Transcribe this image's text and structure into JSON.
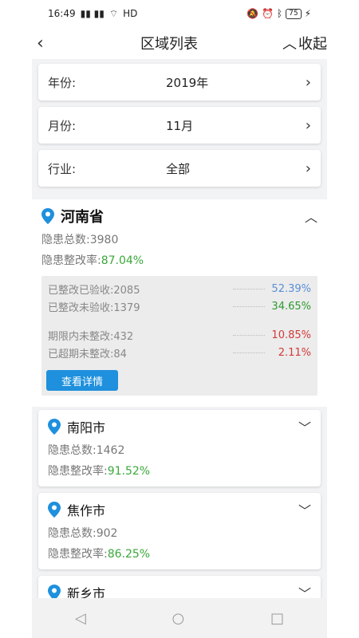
{
  "status": {
    "time": "16:49",
    "signal": "⁴ᴳ ⁴ᴳ",
    "network": "HD",
    "battery": "75"
  },
  "nav": {
    "title": "区域列表",
    "collapse_label": "收起"
  },
  "filters": [
    {
      "label": "年份:",
      "value": "2019年"
    },
    {
      "label": "月份:",
      "value": "11月"
    },
    {
      "label": "行业:",
      "value": "全部"
    }
  ],
  "province": {
    "name": "河南省",
    "total_label": "隐患总数:",
    "total": "3980",
    "rate_label": "隐患整改率:",
    "rate": "87.04%",
    "details": [
      {
        "label": "已整改已验收:",
        "count": "2085",
        "pct": "52.39%"
      },
      {
        "label": "已整改未验收:",
        "count": "1379",
        "pct": "34.65%"
      },
      {
        "label": "期限内未整改:",
        "count": "432",
        "pct": "10.85%"
      },
      {
        "label": "已超期未整改:",
        "count": "84",
        "pct": "2.11%"
      }
    ],
    "detail_button": "查看详情"
  },
  "cities": [
    {
      "name": "南阳市",
      "total_label": "隐患总数:",
      "total": "1462",
      "rate_label": "隐患整改率:",
      "rate": "91.52%"
    },
    {
      "name": "焦作市",
      "total_label": "隐患总数:",
      "total": "902",
      "rate_label": "隐患整改率:",
      "rate": "86.25%"
    },
    {
      "name": "新乡市"
    }
  ],
  "colors": {
    "accent": "#1e90dd",
    "green": "#3aa83a",
    "blue": "#5b8fd6",
    "red": "#d23a3a"
  }
}
